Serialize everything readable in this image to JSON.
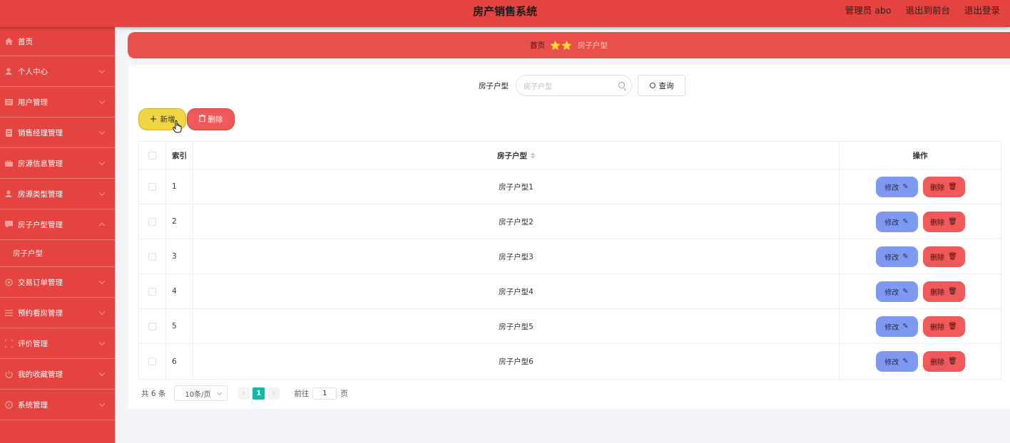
{
  "header": {
    "title": "房产销售系统",
    "links": [
      "管理员 abo",
      "退出到前台",
      "退出登录"
    ]
  },
  "sidebar": {
    "items": [
      {
        "label": "首页",
        "icon": "home-icon",
        "expandable": false
      },
      {
        "label": "个人中心",
        "icon": "user-icon",
        "expandable": true
      },
      {
        "label": "用户管理",
        "icon": "list-icon",
        "expandable": true
      },
      {
        "label": "销售经理管理",
        "icon": "document-icon",
        "expandable": true
      },
      {
        "label": "房源信息管理",
        "icon": "briefcase-icon",
        "expandable": true
      },
      {
        "label": "房源类型管理",
        "icon": "user-icon",
        "expandable": true
      },
      {
        "label": "房子户型管理",
        "icon": "message-icon",
        "expandable": true,
        "expanded": true
      },
      {
        "label": "交易订单管理",
        "icon": "gear-icon",
        "expandable": true
      },
      {
        "label": "预约看房管理",
        "icon": "menu-icon",
        "expandable": true
      },
      {
        "label": "评价管理",
        "icon": "frame-icon",
        "expandable": true
      },
      {
        "label": "我的收藏管理",
        "icon": "power-icon",
        "expandable": true
      },
      {
        "label": "系统管理",
        "icon": "compass-icon",
        "expandable": true
      }
    ],
    "submenu": {
      "label": "房子户型"
    }
  },
  "breadcrumb": {
    "home": "首页",
    "stars": "⭐⭐",
    "current": "房子户型"
  },
  "search": {
    "label": "房子户型",
    "placeholder": "房子户型",
    "button": "查询"
  },
  "actions": {
    "add": "新增",
    "delete": "删除"
  },
  "table": {
    "headers": {
      "index": "索引",
      "name": "房子户型",
      "ops": "操作"
    },
    "rows": [
      {
        "index": "1",
        "name": "房子户型1"
      },
      {
        "index": "2",
        "name": "房子户型2"
      },
      {
        "index": "3",
        "name": "房子户型3"
      },
      {
        "index": "4",
        "name": "房子户型4"
      },
      {
        "index": "5",
        "name": "房子户型5"
      },
      {
        "index": "6",
        "name": "房子户型6"
      }
    ],
    "edit_label": "修改",
    "delete_label": "删除"
  },
  "pagination": {
    "total": "共 6 条",
    "page_size": "10条/页",
    "current_page": "1",
    "goto_label": "前往",
    "goto_value": "1",
    "page_suffix": "页"
  },
  "colors": {
    "primary_red": "#e5433f",
    "yellow": "#f0d545",
    "edit_blue": "#7d9af0",
    "page_teal": "#14b8a6"
  }
}
